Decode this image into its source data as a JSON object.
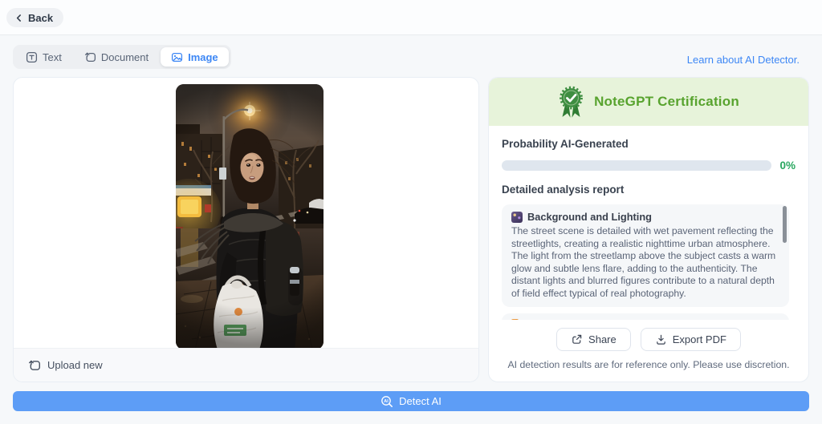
{
  "header": {
    "back_label": "Back",
    "back_icon": "chevron-left-icon"
  },
  "tabs": {
    "items": [
      {
        "label": "Text",
        "icon": "text-icon",
        "active": false
      },
      {
        "label": "Document",
        "icon": "document-icon",
        "active": false
      },
      {
        "label": "Image",
        "icon": "image-icon",
        "active": true
      }
    ]
  },
  "learn_link": {
    "label": "Learn about AI Detector."
  },
  "left_panel": {
    "image_description": "Night street photo: young woman in a dark puffy jacket with backpack and white plastic shopping bag glances back over her shoulder on a wet New York street lit by a glowing orange streetlamp, with storefronts, bare trees and parked cars in the background.",
    "upload_new_label": "Upload new",
    "upload_icon": "upload-icon"
  },
  "right_panel": {
    "badge_icon": "certified-ribbon-icon",
    "certification_title": "NoteGPT Certification",
    "probability_label": "Probability AI-Generated",
    "probability_percent": 0,
    "probability_value": "0%",
    "report_title": "Detailed analysis report",
    "report_sections": [
      {
        "icon": "night-scene-emoji",
        "title": "Background and Lighting",
        "body": "The street scene is detailed with wet pavement reflecting the streetlights, creating a realistic nighttime urban atmosphere. The light from the streetlamp above the subject casts a warm glow and subtle lens flare, adding to the authenticity. The distant lights and blurred figures contribute to a natural depth of field effect typical of real photography."
      }
    ],
    "share_label": "Share",
    "share_icon": "share-icon",
    "export_label": "Export PDF",
    "export_icon": "download-icon",
    "disclaimer": "AI detection results are for reference only. Please use discretion."
  },
  "footer": {
    "detect_label": "Detect AI",
    "detect_icon": "ai-magnifier-icon"
  },
  "colors": {
    "accent_blue": "#5d9df6",
    "link_blue": "#3d87f5",
    "cert_green": "#58a32e",
    "banner_green_bg": "#e7f3da",
    "badge_green": "#3e8e41",
    "progress_track": "#dfe6ee",
    "percent_green": "#29a75f"
  }
}
